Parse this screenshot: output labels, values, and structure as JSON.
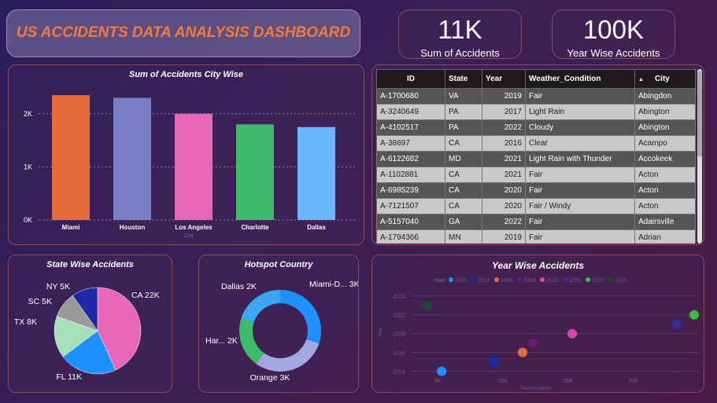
{
  "header": {
    "title": "US ACCIDENTS DATA ANALYSIS DASHBOARD"
  },
  "kpis": [
    {
      "value": "11K",
      "label": "Sum of Accidents"
    },
    {
      "value": "100K",
      "label": "Year Wise Accidents"
    }
  ],
  "chart_data": [
    {
      "type": "bar",
      "title": "Sum of Accidents City Wise",
      "xlabel": "City",
      "categories": [
        "Miami",
        "Houston",
        "Los Angeles",
        "Charlotte",
        "Dallas"
      ],
      "values": [
        2350,
        2300,
        2000,
        1800,
        1750
      ],
      "colors": [
        "#e56b3a",
        "#7b7fc6",
        "#e966b8",
        "#3dbb6b",
        "#6cb8ff"
      ],
      "ylim": [
        0,
        2500
      ],
      "yticks": [
        0,
        1000,
        2000
      ],
      "ytick_labels": [
        "0K",
        "1K",
        "2K"
      ]
    },
    {
      "type": "pie",
      "title": "State Wise Accidents",
      "labels": [
        "CA",
        "FL",
        "TX",
        "SC",
        "NY"
      ],
      "values": [
        22,
        11,
        8,
        5,
        5
      ],
      "display": [
        "CA 22K",
        "FL 11K",
        "TX 8K",
        "SC 5K",
        "NY 5K"
      ],
      "colors": [
        "#e966b8",
        "#1e90ff",
        "#a4e0b8",
        "#9a9a9a",
        "#1c2aa8"
      ]
    },
    {
      "type": "pie",
      "title": "Hotspot Country",
      "donut": true,
      "labels": [
        "Miami-Dade",
        "Orange",
        "Harris",
        "Dallas"
      ],
      "values": [
        3,
        3,
        2,
        2
      ],
      "display": [
        "Miami-D... 3K",
        "Orange 3K",
        "Har... 2K",
        "Dallas 2K"
      ],
      "colors": [
        "#1e90ff",
        "#a3a7e0",
        "#3dbb6b",
        "#3aa7f0"
      ]
    },
    {
      "type": "scatter",
      "title": "Year Wise Accidents",
      "xlabel": "Total Accidents",
      "ylabel": "Year",
      "legend_title": "Year",
      "legend_placement": "top-left",
      "xlim": [
        3000,
        25000
      ],
      "ylim": [
        2015.8,
        2024.4
      ],
      "xticks": [
        5000,
        10000,
        15000,
        20000
      ],
      "xtick_labels": [
        "5K",
        "10K",
        "15K",
        "20K"
      ],
      "yticks": [
        2016,
        2018,
        2020,
        2022,
        2024
      ],
      "series": [
        {
          "name": "2016",
          "x": 5300,
          "y": 2016,
          "color": "#1e90ff"
        },
        {
          "name": "2017",
          "x": 9300,
          "y": 2017,
          "color": "#1c2aa8"
        },
        {
          "name": "2018",
          "x": 11500,
          "y": 2018,
          "color": "#e56b3a"
        },
        {
          "name": "2019",
          "x": 12300,
          "y": 2019,
          "color": "#6a1a7a"
        },
        {
          "name": "2020",
          "x": 15300,
          "y": 2020,
          "color": "#e044b0"
        },
        {
          "name": "2021",
          "x": 23300,
          "y": 2021,
          "color": "#3a2d9a"
        },
        {
          "name": "2022",
          "x": 25300,
          "y": 2022,
          "color": "#3dbb3d"
        },
        {
          "name": "2023",
          "x": 4200,
          "y": 2023,
          "color": "#1d4a2a"
        }
      ]
    }
  ],
  "table": {
    "columns": [
      "ID",
      "State",
      "Year",
      "Weather_Condition",
      "City"
    ],
    "sort_indicator": "▲",
    "rows": [
      [
        "A-1700680",
        "VA",
        "2019",
        "Fair",
        "Abingdon"
      ],
      [
        "A-3240649",
        "PA",
        "2017",
        "Light Rain",
        "Abington"
      ],
      [
        "A-4102517",
        "PA",
        "2022",
        "Cloudy",
        "Abington"
      ],
      [
        "A-38697",
        "CA",
        "2016",
        "Clear",
        "Acampo"
      ],
      [
        "A-6122682",
        "MD",
        "2021",
        "Light Rain with Thunder",
        "Accokeek"
      ],
      [
        "A-1102881",
        "CA",
        "2021",
        "Fair",
        "Acton"
      ],
      [
        "A-6985239",
        "CA",
        "2020",
        "Fair",
        "Acton"
      ],
      [
        "A-7121507",
        "CA",
        "2020",
        "Fair / Windy",
        "Acton"
      ],
      [
        "A-5157040",
        "GA",
        "2022",
        "Fair",
        "Adairsville"
      ],
      [
        "A-1794366",
        "MN",
        "2019",
        "Fair",
        "Adrian"
      ]
    ]
  }
}
